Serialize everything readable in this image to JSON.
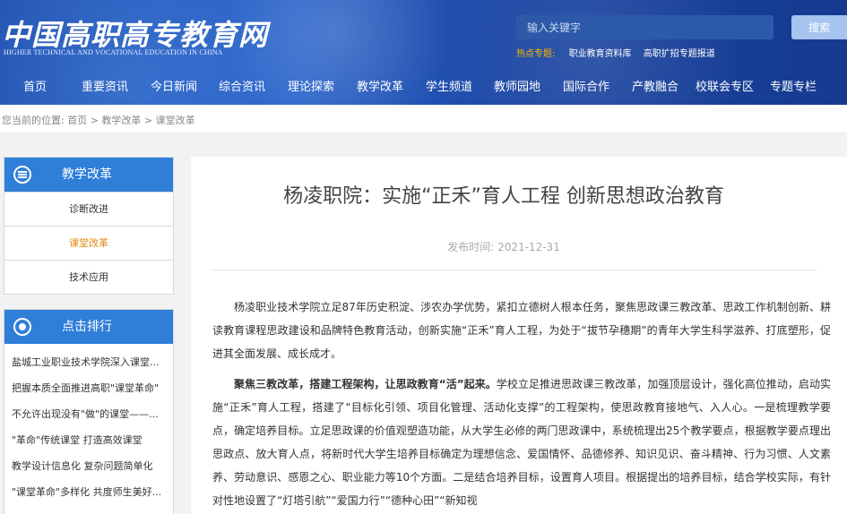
{
  "header": {
    "logo": "中国高职高专教育网",
    "logo_sub": "HIGHER TECHNICAL AND VOCATIONAL EDUCATION IN CHINA",
    "search_placeholder": "输入关键字",
    "search_button": "搜索",
    "hot_label": "热点专题:",
    "hot_links": [
      "职业教育资料库",
      "高职扩招专题报道"
    ]
  },
  "nav": [
    "首页",
    "重要资讯",
    "今日新闻",
    "综合资讯",
    "理论探索",
    "教学改革",
    "学生频道",
    "教师园地",
    "国际合作",
    "产教融合",
    "校联会专区",
    "专题专栏"
  ],
  "breadcrumb": "您当前的位置:  首页 > 教学改革 > 课堂改革",
  "sidebar": {
    "section_title": "教学改革",
    "items": [
      "诊断改进",
      "课堂改革",
      "技术应用"
    ],
    "active_index": 1,
    "rank_title": "点击排行",
    "rank_items": [
      "盐城工业职业技术学院深入课堂...",
      "把握本质全面推进高职\"课堂革命\"",
      "不允许出现没有\"做\"的课堂——...",
      "\"革命\"传统课堂 打造高效课堂",
      "教学设计信息化 复杂问题简单化",
      "\"课堂革命\"多样化 共度师生美好..."
    ]
  },
  "article": {
    "title": "杨凌职院：实施“正禾”育人工程 创新思想政治教育",
    "pub_label": "发布时间:",
    "pub_date": "2021-12-31",
    "para1": "杨凌职业技术学院立足87年历史积淀、涉农办学优势，紧扣立德树人根本任务，聚焦思政课三教改革、思政工作机制创新、耕读教育课程思政建设和品牌特色教育活动，创新实施“正禾”育人工程，为处于“拔节孕穗期”的青年大学生科学滋养、打底塑形，促进其全面发展、成长成才。",
    "para2_bold": "聚焦三教改革，搭建工程架构，让思政教育“活”起来。",
    "para2_rest": "学校立足推进思政课三教改革，加强顶层设计，强化高位推动，启动实施“正禾”育人工程，搭建了“目标化引领、项目化管理、活动化支撑”的工程架构，使思政教育接地气、入人心。一是梳理教学要点，确定培养目标。立足思政课的价值观塑造功能，从大学生必修的两门思政课中，系统梳理出25个教学要点，根据教学要点理出思政点、放大育人点，将新时代大学生培养目标确定为理想信念、爱国情怀、品德修养、知识见识、奋斗精神、行为习惯、人文素养、劳动意识、感恩之心、职业能力等10个方面。二是结合培养目标，设置育人项目。根据提出的培养目标，结合学校实际，有针对性地设置了“灯塔引航”“爱国力行”“德种心田”“新知视"
  }
}
